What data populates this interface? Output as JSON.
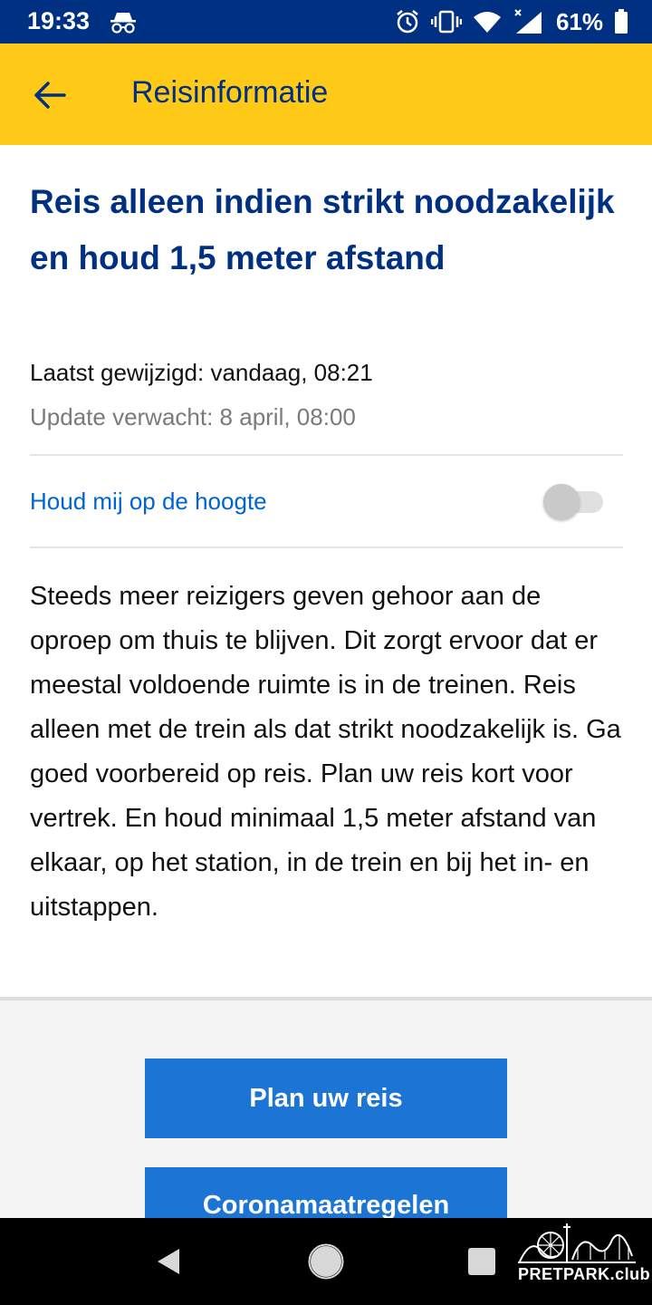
{
  "status_bar": {
    "time": "19:33",
    "battery": "61%",
    "icons": [
      "incognito-icon",
      "alarm-icon",
      "vibrate-icon",
      "wifi-icon",
      "signal-icon",
      "battery-icon"
    ]
  },
  "app_bar": {
    "back_icon": "arrow-left-icon",
    "title": "Reisinformatie"
  },
  "content": {
    "headline": "Reis alleen indien strikt noodzakelijk en houd 1,5 meter afstand",
    "last_modified": "Laatst gewijzigd: vandaag, 08:21",
    "update_expected": "Update verwacht: 8 april, 08:00",
    "notify_label": "Houd mij op de hoogte",
    "notify_enabled": false,
    "body": "Steeds meer reizigers geven gehoor aan de oproep om thuis te blijven. Dit zorgt ervoor dat er meestal voldoende ruimte is in de treinen. Reis alleen met de trein als dat strikt noodzakelijk is. Ga goed voorbereid op reis. Plan uw reis kort voor vertrek. En houd minimaal 1,5 meter afstand van elkaar, op het station, in de trein en bij het in- en uitstappen."
  },
  "actions": {
    "plan_label": "Plan uw reis",
    "corona_label": "Coronamaatregelen"
  },
  "nav_bar": {
    "icons": [
      "nav-back-icon",
      "nav-home-icon",
      "nav-recents-icon"
    ]
  },
  "watermark": {
    "text": "PRETPARK.club"
  },
  "colors": {
    "status_bar": "#003082",
    "app_bar": "#ffc917",
    "primary_text": "#003082",
    "link": "#0063d3",
    "button": "#1c74d4"
  }
}
